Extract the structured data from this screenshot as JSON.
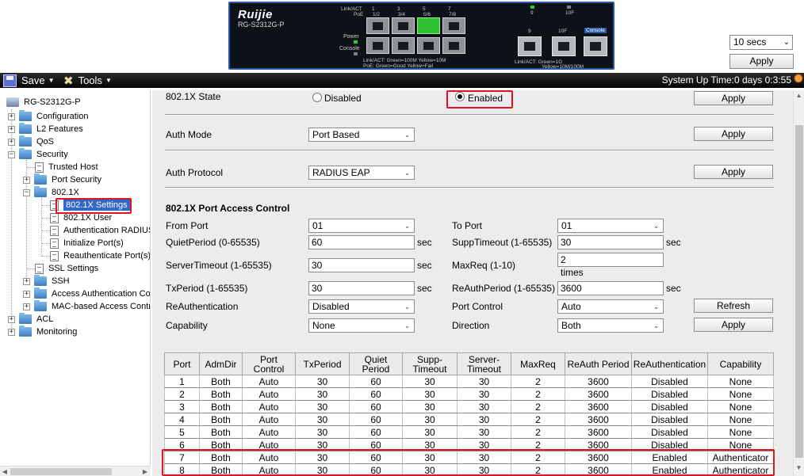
{
  "device": {
    "brand": "Ruijie",
    "model": "RG-S2312G-P",
    "top_legend": [
      "Link/ACT",
      "PoE"
    ],
    "port_nums_top": [
      "1",
      "2",
      "3",
      "4",
      "5",
      "6",
      "7",
      "8"
    ],
    "port_pairs": [
      "1/2",
      "3/4",
      "5/6",
      "7/8"
    ],
    "uplink_nums": [
      "9",
      "10F"
    ],
    "uplink_labels": [
      "9",
      "10F",
      "Console"
    ],
    "power_label": "Power",
    "console_label": "Console",
    "bottom_legend_1": "Link/ACT: Green=100M Yellow=10M",
    "bottom_legend_2": "PoE:      Green=Good Yellow=Fail",
    "uplink_legend_1": "Link/ACT: Green=1G",
    "uplink_legend_2": "Yellow=10M/100M"
  },
  "refresh": {
    "interval": "10 secs",
    "apply_label": "Apply"
  },
  "toolbar": {
    "save_label": "Save",
    "tools_label": "Tools",
    "uptime": "System Up Time:0 days 0:3:55"
  },
  "tree": {
    "root": "RG-S2312G-P",
    "items": [
      {
        "label": "Configuration"
      },
      {
        "label": "L2 Features"
      },
      {
        "label": "QoS"
      },
      {
        "label": "Security"
      },
      {
        "label": "Trusted Host"
      },
      {
        "label": "Port Security"
      },
      {
        "label": "802.1X"
      },
      {
        "label": "802.1X Settings"
      },
      {
        "label": "802.1X User"
      },
      {
        "label": "Authentication RADIUS"
      },
      {
        "label": "Initialize Port(s)"
      },
      {
        "label": "Reauthenticate Port(s)"
      },
      {
        "label": "SSL Settings"
      },
      {
        "label": "SSH"
      },
      {
        "label": "Access Authentication Co"
      },
      {
        "label": "MAC-based Access Contr"
      },
      {
        "label": "ACL"
      },
      {
        "label": "Monitoring"
      }
    ]
  },
  "state": {
    "label": "802.1X State",
    "disabled_label": "Disabled",
    "enabled_label": "Enabled",
    "selected": "Enabled",
    "apply_label": "Apply"
  },
  "auth_mode": {
    "label": "Auth Mode",
    "value": "Port Based",
    "apply_label": "Apply"
  },
  "auth_protocol": {
    "label": "Auth Protocol",
    "value": "RADIUS EAP",
    "apply_label": "Apply"
  },
  "pac": {
    "title": "802.1X Port Access Control",
    "from_port_label": "From Port",
    "from_port": "01",
    "to_port_label": "To Port",
    "to_port": "01",
    "quiet_label": "QuietPeriod (0-65535)",
    "quiet": "60",
    "supp_label": "SuppTimeout (1-65535)",
    "supp": "30",
    "server_label": "ServerTimeout (1-65535)",
    "server": "30",
    "maxreq_label": "MaxReq (1-10)",
    "maxreq": "2",
    "times": "times",
    "tx_label": "TxPeriod (1-65535)",
    "tx": "30",
    "reauthp_label": "ReAuthPeriod (1-65535)",
    "reauthp": "3600",
    "reauth_label": "ReAuthentication",
    "reauth": "Disabled",
    "portctl_label": "Port Control",
    "portctl": "Auto",
    "cap_label": "Capability",
    "cap": "None",
    "dir_label": "Direction",
    "dir": "Both",
    "sec": "sec",
    "refresh_label": "Refresh",
    "apply_label": "Apply"
  },
  "table": {
    "headers": [
      "Port",
      "AdmDir",
      "Port Control",
      "TxPeriod",
      "Quiet\nPeriod",
      "Supp-\nTimeout",
      "Server-\nTimeout",
      "MaxReq",
      "ReAuth Period",
      "ReAuthentication",
      "Capability"
    ],
    "rows": [
      [
        "1",
        "Both",
        "Auto",
        "30",
        "60",
        "30",
        "30",
        "2",
        "3600",
        "Disabled",
        "None"
      ],
      [
        "2",
        "Both",
        "Auto",
        "30",
        "60",
        "30",
        "30",
        "2",
        "3600",
        "Disabled",
        "None"
      ],
      [
        "3",
        "Both",
        "Auto",
        "30",
        "60",
        "30",
        "30",
        "2",
        "3600",
        "Disabled",
        "None"
      ],
      [
        "4",
        "Both",
        "Auto",
        "30",
        "60",
        "30",
        "30",
        "2",
        "3600",
        "Disabled",
        "None"
      ],
      [
        "5",
        "Both",
        "Auto",
        "30",
        "60",
        "30",
        "30",
        "2",
        "3600",
        "Disabled",
        "None"
      ],
      [
        "6",
        "Both",
        "Auto",
        "30",
        "60",
        "30",
        "30",
        "2",
        "3600",
        "Disabled",
        "None"
      ],
      [
        "7",
        "Both",
        "Auto",
        "30",
        "60",
        "30",
        "30",
        "2",
        "3600",
        "Enabled",
        "Authenticator"
      ],
      [
        "8",
        "Both",
        "Auto",
        "30",
        "60",
        "30",
        "30",
        "2",
        "3600",
        "Enabled",
        "Authenticator"
      ]
    ]
  },
  "colors": {
    "highlight": "#e0141e",
    "selection": "#3168c8",
    "panel_bg": "#ececec",
    "toolbar_bg": "#0a0a0a"
  }
}
